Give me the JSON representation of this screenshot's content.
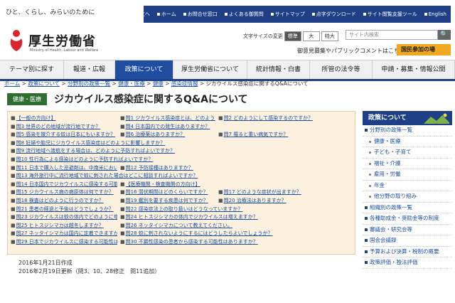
{
  "top": {
    "tagline": "ひと、くらし、みらいのために",
    "utilities": [
      "本文へ",
      "ホーム",
      "お問合せ窓口",
      "よくある御質問",
      "サイトマップ",
      "点字ダウンロード",
      "サイト閲覧支援ツール",
      "English"
    ]
  },
  "header": {
    "logo_jp": "厚生労働省",
    "logo_en": "Ministry of Health, Labour and Welfare",
    "font_size_label": "文字サイズの変更",
    "font_sizes": [
      "標準",
      "大",
      "特大"
    ],
    "search_placeholder": "サイト内検索",
    "search_button": "🔍",
    "pub_comment": "御意見募集やパブリックコメントはこちら",
    "kokumin": "国民参加の場"
  },
  "gnav": [
    "テーマ別に探す",
    "報道・広報",
    "政策について",
    "厚生労働省について",
    "統計情報・白書",
    "所管の法令等",
    "申請・募集・情報公開"
  ],
  "breadcrumb": [
    "ホーム",
    "政策について",
    "分野別の政策一覧",
    "健康・医療",
    "健康",
    "感染症情報",
    "ジカウイルス感染症に関するQ&Aについて"
  ],
  "page": {
    "category": "健康・医療",
    "title": "ジカウイルス感染症に関するQ&Aについて"
  },
  "qa_rows": [
    [
      "【一般の方向け】",
      "問1 ジカウイルス感染症とは、どのような病気ですか？",
      "問2 どのようにして感染するのですか？"
    ],
    [
      "問3 世界のどの地域が流行地ですか？",
      "問4 日本国内での発生はありますか？"
    ],
    [
      "問5 感染を媒介する蚊は日本にもいますか？",
      "問6 治療薬はありますか？",
      "問7 罹ると重い病気ですか？"
    ],
    [
      "問8 妊婦や胎児にジカウイルス感染症はどのように影響しますか？"
    ],
    [
      "問9 流行地域へ渡航をする場合は、どのように予防すればよいですか？"
    ],
    [
      "問10 性行為による感染はどのように予防すればよいですか？"
    ],
    [
      "問11 日本で購入した忌避剤は、中南米においても効果がありますか？",
      "問12 予防接種はありますか？"
    ],
    [
      "問13 海外旅行中に流行地域で蚊に刺された場合はどこに相談すればよいですか？"
    ],
    [
      "問14 日本国内でジカウイルスに感染する可能性はあるのでしょうか？",
      "【医療機関・検査機関の方向け】"
    ],
    [
      "問15 ジカウイルス病の病原体は何ですか？",
      "問16 潜伏期間はどのくらいですか？",
      "問17 どのような症状が出ますか？"
    ],
    [
      "問18 検査はどのように行うのですか？",
      "問19 鑑別を要する疾患は何ですか？",
      "問20 治療法はありますか？"
    ],
    [
      "問21 患者の経過と予後はどうでしょうか？",
      "問22 感染症法上の取り扱いはどうなっていますか？"
    ],
    [
      "問23 ジカウイルスは蚊の体内でどのように増えますか？",
      "問24 ヒトスジシマカの体内でジカウイルスは増えますか？"
    ],
    [
      "問25 ヒトスジシマカは越冬しますか？",
      "問26 ネッタイシマカについて教えてください。"
    ],
    [
      "問27 ネッタイシマカは国内に定着できますか？",
      "問28 蚊に刺されないようにするにはどうしたらよいでしょうか？"
    ],
    [
      "問29 日本でジカウイルスに感染する可能性はありますか？",
      "問30 不顕性感染の患者から感染する可能性はありますか？"
    ]
  ],
  "dates": {
    "created": "2016年1月21日作成",
    "revised": "2016年2月19日更新（問3、10、28修正　問11追加）"
  },
  "sidebar": {
    "title": "政策について",
    "items": [
      {
        "label": "分野別の政策一覧",
        "sub": false
      },
      {
        "label": "健康・医療",
        "sub": true
      },
      {
        "label": "子ども・子育て",
        "sub": true
      },
      {
        "label": "福祉・介護",
        "sub": true
      },
      {
        "label": "雇用・労働",
        "sub": true
      },
      {
        "label": "年金",
        "sub": true
      },
      {
        "label": "他分野の取り組み",
        "sub": true
      },
      {
        "label": "組織別の政策一覧",
        "sub": false
      },
      {
        "label": "各種助成金・奨励金等の制度",
        "sub": false
      },
      {
        "label": "審議会・研究会等",
        "sub": false
      },
      {
        "label": "国会会議録",
        "sub": false
      },
      {
        "label": "予算および決算・税制の概要",
        "sub": false
      },
      {
        "label": "政策評価・独法評価",
        "sub": false
      }
    ]
  },
  "colors": {
    "navy": "#1f3f87",
    "nav_active": "#1f4ea0",
    "badge_green": "#2f6e2f",
    "qa_bg": "#fbf1de",
    "orange": "#f0a91e"
  }
}
